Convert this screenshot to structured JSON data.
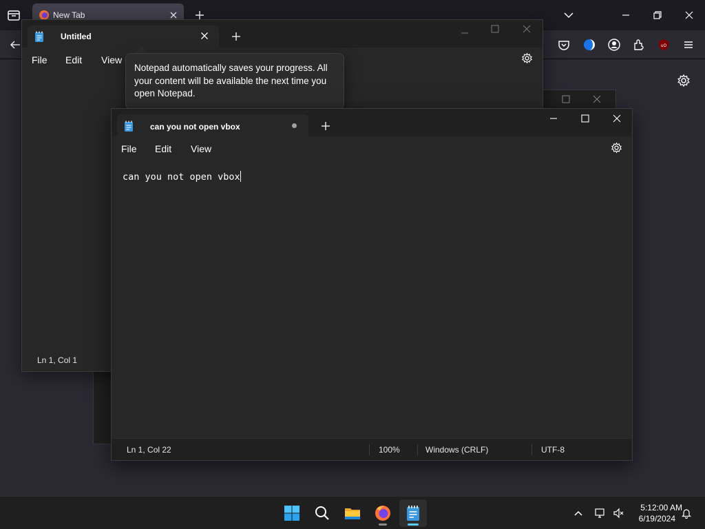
{
  "firefox": {
    "tab_title": "New Tab"
  },
  "notepad_back": {
    "tab_title": "Untitled",
    "menu": [
      "File",
      "Edit",
      "View"
    ],
    "status": "Ln 1, Col 1",
    "tooltip": "Notepad automatically saves your progress. All your content will be available the next time you open Notepad."
  },
  "notepad_front": {
    "tab_title": "can you not open vbox",
    "menu": [
      "File",
      "Edit",
      "View"
    ],
    "content": "can you not open vbox",
    "status": {
      "position": "Ln 1, Col 22",
      "zoom": "100%",
      "line_ending": "Windows (CRLF)",
      "encoding": "UTF-8"
    }
  },
  "taskbar": {
    "apps": [
      "start-icon",
      "search-icon",
      "file-explorer-icon",
      "firefox-icon",
      "notepad-icon"
    ],
    "clock_time": "5:12:00 AM",
    "clock_date": "6/19/2024"
  },
  "colors": {
    "accent": "#60cdff",
    "background": "#202020",
    "editor": "#272727"
  }
}
